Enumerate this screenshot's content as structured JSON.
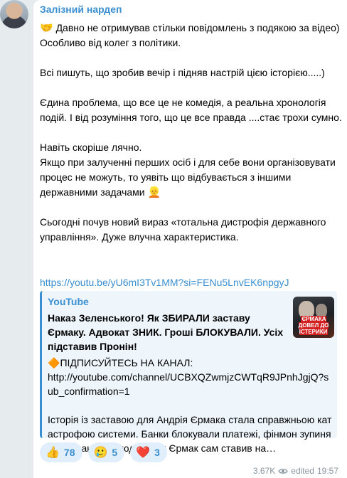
{
  "post": {
    "author": "Залізний нардеп",
    "emoji_handshake": "🤝",
    "paragraphs": [
      "Давно не отримував стільки повідомлень з подякою за відео) Особливо від колег з політики.",
      "Всі пишуть, що зробив вечір і підняв настрій цією історією.....)",
      "Єдина проблема, що все це не комедія, а реальна хронологія подій. І від розуміння того, що це все правда ....стає трохи сумно.",
      "Навіть скоріше лячно.\nЯкщо при залученні перших осіб і для себе вони організовувати процес не можуть, то уявіть що відбувається з іншими державними задачами",
      "Сьогодні почув новий вираз «тотальна дистрофія державного управління». Дуже влучна характеристика."
    ],
    "emoji_person": "👱",
    "link": "https://youtu.be/yU6mI3Tv1MM?si=FENu5LnvEK6npgyJ"
  },
  "preview": {
    "site": "YouTube",
    "title": "Наказ Зеленського! Як ЗБИРАЛИ заставу Єрмаку. Адвокат ЗНИК. Гроші БЛОКУВАЛИ. Усіх підставив Пронін!",
    "subscribe_emoji": "🔶",
    "desc_1": "ПІДПИСУЙТЕСЬ НА КАНАЛ:\nhttp://youtube.com/channel/UCBXQZwmjzCWTqR9JPnhJgjQ?sub_confirmation=1",
    "desc_2": "Історія із заставою для Андрія Єрмака стала справжньою катастрофою системи. Банки блокували платежі, фінмон зупиняв транзакції, а люди, яких Єрмак сам ставив на…",
    "thumb_caption": "ЄРМАКА ДОВЕЛ ДО ІСТЕРИКИ"
  },
  "reactions": [
    {
      "emoji": "👍",
      "count": "78"
    },
    {
      "emoji": "🥲",
      "count": "5"
    },
    {
      "emoji": "❤️",
      "count": "3"
    }
  ],
  "meta": {
    "views": "3.67K",
    "edited": "edited",
    "time": "19:57"
  },
  "colors": {
    "accent": "#3a8fd0",
    "background": "#e6ebee",
    "bubble": "#ffffff",
    "preview_bg": "#eef6fc",
    "reaction_bg": "#e1eefb",
    "meta": "#8a959e"
  }
}
